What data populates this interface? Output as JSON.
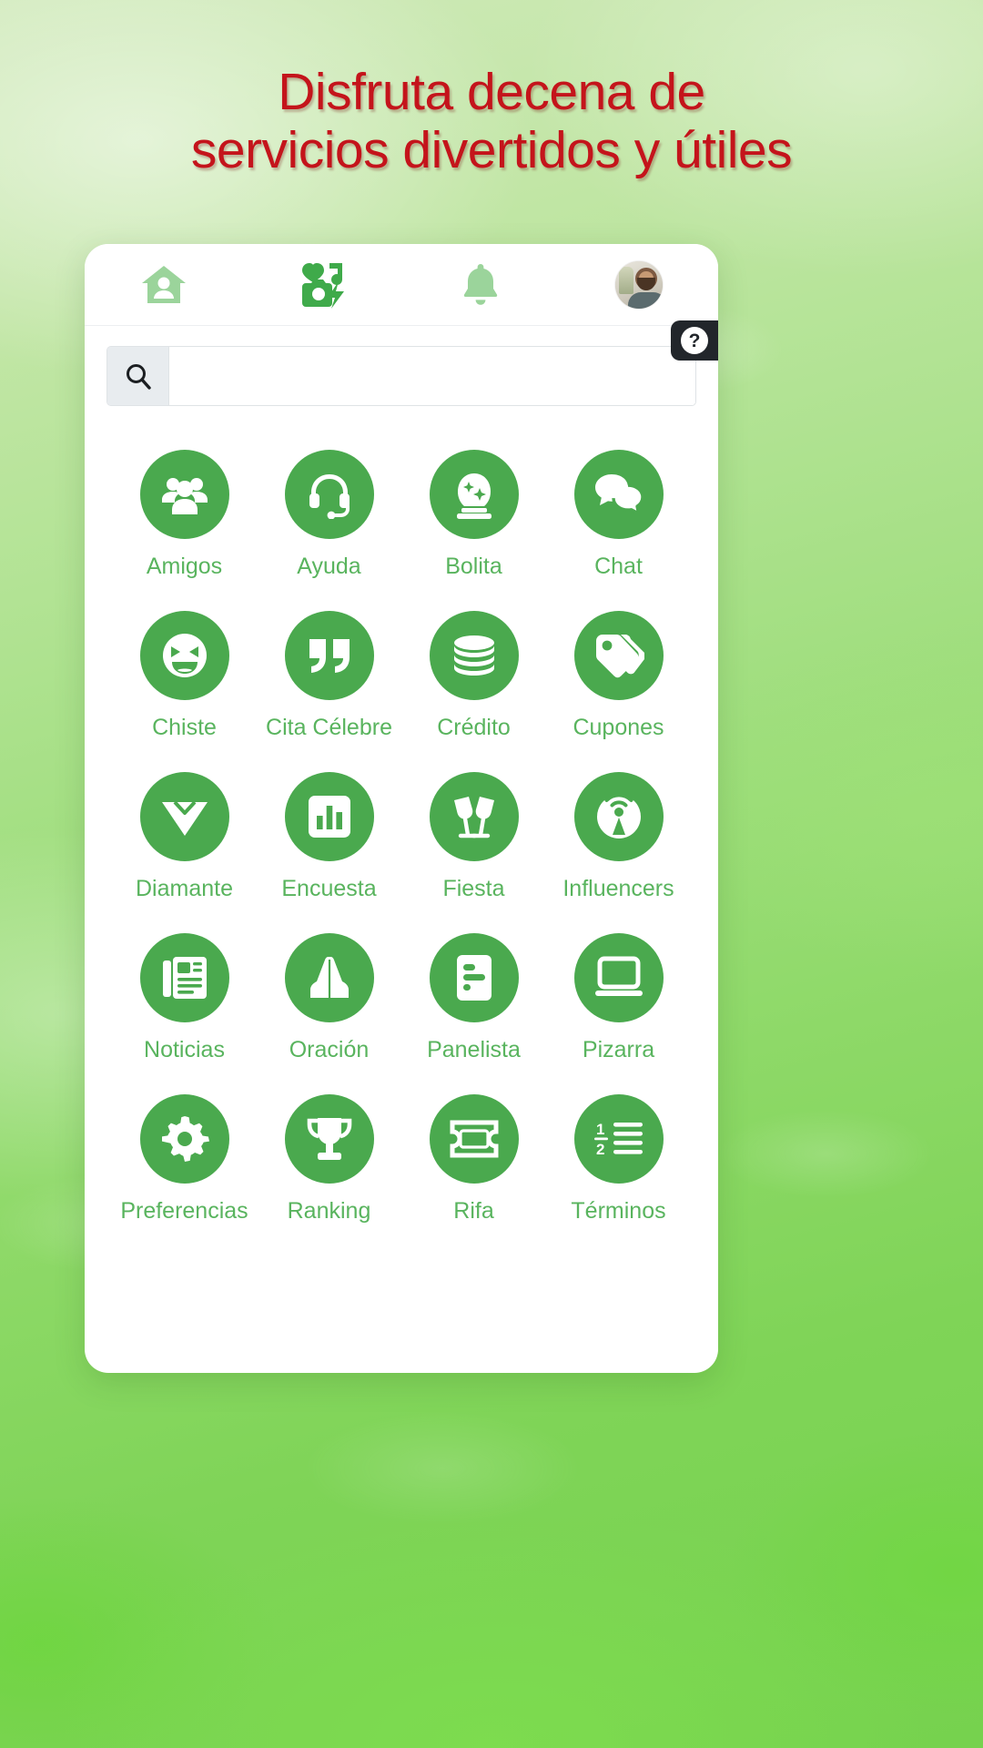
{
  "headline": {
    "line1": "Disfruta decena de",
    "line2": "servicios divertidos y útiles",
    "color": "#c4141b"
  },
  "theme": {
    "brand_green": "#4aa94e",
    "label_green": "#59b45e",
    "nav_icon_green": "#9bd49b",
    "nav_icon_active_green": "#3faa4a",
    "background_green": "#8ed873",
    "badge_dark": "#22262b"
  },
  "navbar": {
    "items": [
      {
        "name": "home-icon",
        "label": "Inicio",
        "state": "inactive"
      },
      {
        "name": "feed-media-icon",
        "label": "Novedades",
        "state": "active"
      },
      {
        "name": "bell-icon",
        "label": "Notificaciones",
        "state": "inactive"
      },
      {
        "name": "avatar",
        "label": "Perfil",
        "state": "photo"
      }
    ]
  },
  "search": {
    "icon": "search-icon",
    "value": "",
    "placeholder": ""
  },
  "help_badge": {
    "icon": "question-mark-icon",
    "label": "?"
  },
  "grid": {
    "items": [
      {
        "label": "Amigos",
        "icon": "users-group-icon"
      },
      {
        "label": "Ayuda",
        "icon": "headset-icon"
      },
      {
        "label": "Bolita",
        "icon": "crystal-ball-icon"
      },
      {
        "label": "Chat",
        "icon": "chat-bubbles-icon"
      },
      {
        "label": "Chiste",
        "icon": "laughing-face-icon"
      },
      {
        "label": "Cita Célebre",
        "icon": "quote-marks-icon"
      },
      {
        "label": "Crédito",
        "icon": "coins-stack-icon"
      },
      {
        "label": "Cupones",
        "icon": "tags-icon"
      },
      {
        "label": "Diamante",
        "icon": "diamond-icon"
      },
      {
        "label": "Encuesta",
        "icon": "bar-chart-icon"
      },
      {
        "label": "Fiesta",
        "icon": "champagne-glasses-icon"
      },
      {
        "label": "Influencers",
        "icon": "broadcast-icon"
      },
      {
        "label": "Noticias",
        "icon": "newspaper-icon"
      },
      {
        "label": "Oración",
        "icon": "praying-hands-icon"
      },
      {
        "label": "Panelista",
        "icon": "poll-document-icon"
      },
      {
        "label": "Pizarra",
        "icon": "whiteboard-icon"
      },
      {
        "label": "Preferencias",
        "icon": "gear-icon"
      },
      {
        "label": "Ranking",
        "icon": "trophy-icon"
      },
      {
        "label": "Rifa",
        "icon": "ticket-icon"
      },
      {
        "label": "Términos",
        "icon": "numbered-list-icon"
      }
    ]
  }
}
